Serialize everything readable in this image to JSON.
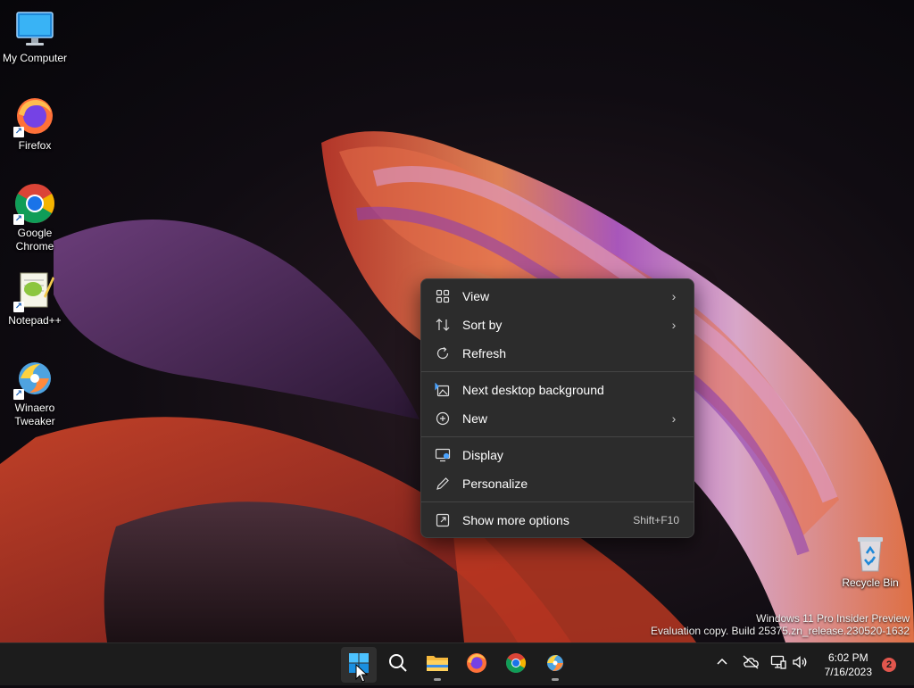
{
  "desktop": {
    "icons": [
      {
        "label": "My Computer",
        "icon": "monitor-icon"
      },
      {
        "label": "Firefox",
        "icon": "firefox-icon"
      },
      {
        "label": "Google Chrome",
        "line1": "Google",
        "line2": "Chrome",
        "icon": "chrome-icon"
      },
      {
        "label": "Notepad++",
        "icon": "notepad-plus-plus-icon"
      },
      {
        "label": "Winaero Tweaker",
        "line1": "Winaero",
        "line2": "Tweaker",
        "icon": "winaero-tweaker-icon"
      },
      {
        "label": "Recycle Bin",
        "icon": "recycle-bin-icon"
      }
    ]
  },
  "context_menu": {
    "items": [
      {
        "label": "View",
        "icon": "grid-icon",
        "submenu": true
      },
      {
        "label": "Sort by",
        "icon": "sort-icon",
        "submenu": true
      },
      {
        "label": "Refresh",
        "icon": "refresh-icon",
        "submenu": false
      },
      {
        "label": "Next desktop background",
        "icon": "next-background-icon",
        "submenu": false
      },
      {
        "label": "New",
        "icon": "plus-circle-icon",
        "submenu": true
      },
      {
        "label": "Display",
        "icon": "display-icon",
        "submenu": false
      },
      {
        "label": "Personalize",
        "icon": "pen-icon",
        "submenu": false
      },
      {
        "label": "Show more options",
        "icon": "open-external-icon",
        "shortcut": "Shift+F10"
      }
    ]
  },
  "watermark": {
    "line1": "Windows 11 Pro Insider Preview",
    "line2": "Evaluation copy. Build 25375.zn_release.230520-1632"
  },
  "taskbar": {
    "apps": [
      "start-icon",
      "search-icon",
      "file-explorer-icon",
      "firefox-icon",
      "chrome-icon",
      "winaero-tweaker-icon"
    ],
    "clock": {
      "time": "6:02 PM",
      "date": "7/16/2023"
    },
    "notification_count": "2"
  },
  "colors": {
    "menu_bg": "#2c2c2c",
    "taskbar_bg": "#1c1c1c",
    "accent": "#0078d4",
    "badge": "#e2564d"
  }
}
